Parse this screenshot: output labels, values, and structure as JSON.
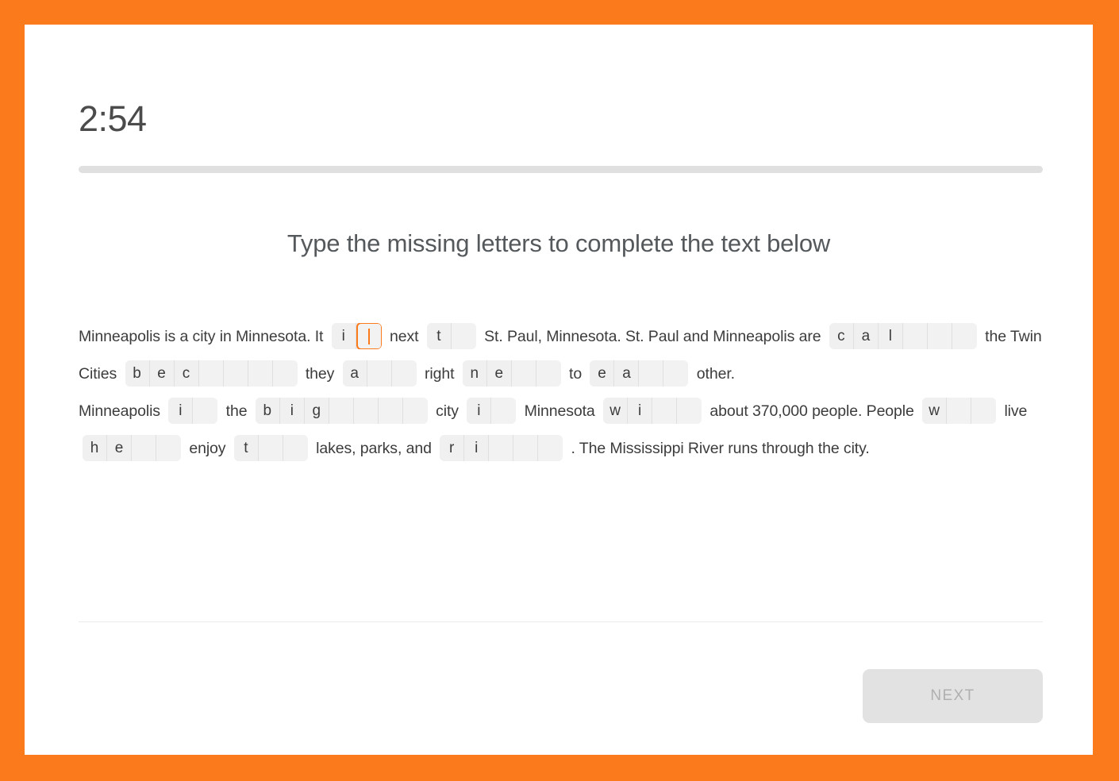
{
  "frame": {
    "accent_color": "#fb7a1c",
    "card_background": "#ffffff"
  },
  "header": {
    "timer": "2:54",
    "progress_percent": 0,
    "progress_track_color": "#e0e0e0"
  },
  "prompt": {
    "title": "Type the missing letters to complete the text below"
  },
  "exercise": {
    "tokens": [
      {
        "kind": "text",
        "text": "Minneapolis is a city in Minnesota. It"
      },
      {
        "kind": "blank",
        "id": "blank-1",
        "filled": "i",
        "length": 2,
        "active_index": 1
      },
      {
        "kind": "text",
        "text": "next"
      },
      {
        "kind": "blank",
        "id": "blank-2",
        "filled": "t",
        "length": 2
      },
      {
        "kind": "text",
        "text": "St. Paul, Minnesota. St. Paul and Minneapolis are"
      },
      {
        "kind": "blank",
        "id": "blank-3",
        "filled": "cal",
        "length": 6
      },
      {
        "kind": "text",
        "text": "the Twin Cities"
      },
      {
        "kind": "blank",
        "id": "blank-4",
        "filled": "bec",
        "length": 7
      },
      {
        "kind": "text",
        "text": "they"
      },
      {
        "kind": "blank",
        "id": "blank-5",
        "filled": "a",
        "length": 3
      },
      {
        "kind": "text",
        "text": "right"
      },
      {
        "kind": "blank",
        "id": "blank-6",
        "filled": "ne",
        "length": 4
      },
      {
        "kind": "text",
        "text": "to"
      },
      {
        "kind": "blank",
        "id": "blank-7",
        "filled": "ea",
        "length": 4
      },
      {
        "kind": "text",
        "text": "other."
      },
      {
        "kind": "break"
      },
      {
        "kind": "text",
        "text": "Minneapolis"
      },
      {
        "kind": "blank",
        "id": "blank-8",
        "filled": "i",
        "length": 2
      },
      {
        "kind": "text",
        "text": "the"
      },
      {
        "kind": "blank",
        "id": "blank-9",
        "filled": "big",
        "length": 7
      },
      {
        "kind": "text",
        "text": "city"
      },
      {
        "kind": "blank",
        "id": "blank-10",
        "filled": "i",
        "length": 2
      },
      {
        "kind": "text",
        "text": "Minnesota"
      },
      {
        "kind": "blank",
        "id": "blank-11",
        "filled": "wi",
        "length": 4
      },
      {
        "kind": "text",
        "text": "about 370,000 people. People"
      },
      {
        "kind": "blank",
        "id": "blank-12",
        "filled": "w",
        "length": 3
      },
      {
        "kind": "text",
        "text": "live"
      },
      {
        "kind": "blank",
        "id": "blank-13",
        "filled": "he",
        "length": 4
      },
      {
        "kind": "text",
        "text": "enjoy"
      },
      {
        "kind": "blank",
        "id": "blank-14",
        "filled": "t",
        "length": 3
      },
      {
        "kind": "text",
        "text": "lakes, parks, and"
      },
      {
        "kind": "blank",
        "id": "blank-15",
        "filled": "ri",
        "length": 5
      },
      {
        "kind": "text",
        "text": ". The Mississippi River runs through the city."
      }
    ]
  },
  "footer": {
    "next_label": "NEXT",
    "next_enabled": false
  }
}
